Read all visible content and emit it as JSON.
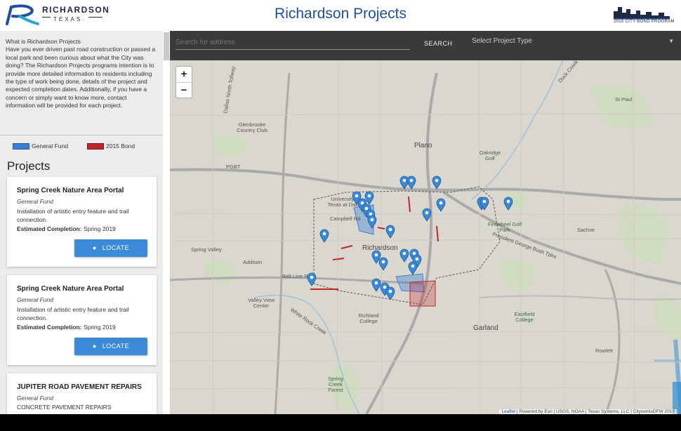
{
  "header": {
    "logo_word": "RICHARDSON",
    "logo_sub": "TEXAS",
    "title": "Richardson Projects",
    "bond_logo_caption": "2015 CITY BOND PROGRAM"
  },
  "sidebar": {
    "about_title": "What is Richardson Projects",
    "about_text": "Have you ever driven past road construction or passed a local park and been curious about what the City was doing? The Richardson Projects programs intention is to provide more detailed information to residents including the type of work being done, details of the project and expected completion dates. Additionally, if you have a concern or simply want to know more, contact information will be provided for each project.",
    "legend": [
      {
        "label": "General Fund",
        "color": "#3b7fd4"
      },
      {
        "label": "2015 Bond",
        "color": "#c0272d"
      }
    ],
    "projects_heading": "Projects",
    "projects": [
      {
        "title": "Spring Creek Nature Area Portal",
        "fund": "General Fund",
        "description": "Installation of artistic entry feature and trail connection.",
        "completion_label": "Estimated Completion:",
        "completion_value": "Spring 2019",
        "button": "LOCATE"
      },
      {
        "title": "Spring Creek Nature Area Portal",
        "fund": "General Fund",
        "description": "Installation of artistic entry feature and trail connection.",
        "completion_label": "Estimated Completion:",
        "completion_value": "Spring 2019",
        "button": "LOCATE"
      },
      {
        "title": "JUPITER ROAD PAVEMENT REPAIRS",
        "fund": "General Fund",
        "description": "CONCRETE PAVEMENT REPAIRS",
        "completion_label": "",
        "completion_value": "",
        "button": ""
      }
    ]
  },
  "search": {
    "placeholder": "Search for address",
    "button": "SEARCH",
    "select_label": "Select Project Type"
  },
  "map": {
    "zoom_in": "+",
    "zoom_out": "−",
    "attribution_link": "Leaflet",
    "attribution_text": " | Powered by Esri | USGS, NOAA | Texas Systems, LLC | CityworksDFW 2019",
    "labels": {
      "plano": "Plano",
      "richardson": "Richardson",
      "garland": "Garland",
      "addison": "Addison",
      "rowlett": "Rowlett",
      "sachse": "Sachse",
      "pgbt": "PGBT",
      "st_paul": "St Paul",
      "glenn_heights": "Glenbrooke Country Club",
      "dallas_north_tollway": "Dallas North Tollway",
      "utd": "University of Texas at Dallas",
      "richland": "Richland College",
      "valley_view": "Valley View Center",
      "campbell": "Campbell Rd",
      "beltline": "Belt Line Rd",
      "president_george": "President George Bush Tpke",
      "spring_valley": "Spring Valley",
      "white_rock": "White Rock Creek",
      "duck_creek": "Duck Creek",
      "firewheel": "Firewheel Golf Park",
      "eastfield": "Eastfield College",
      "oak_ridge": "Oakridge Golf",
      "spring_park": "Spring Creek Forest"
    },
    "marker_color": "#3b8ad8",
    "general_fund_color": "#3b7fd4",
    "bond_color": "#c0272d"
  }
}
